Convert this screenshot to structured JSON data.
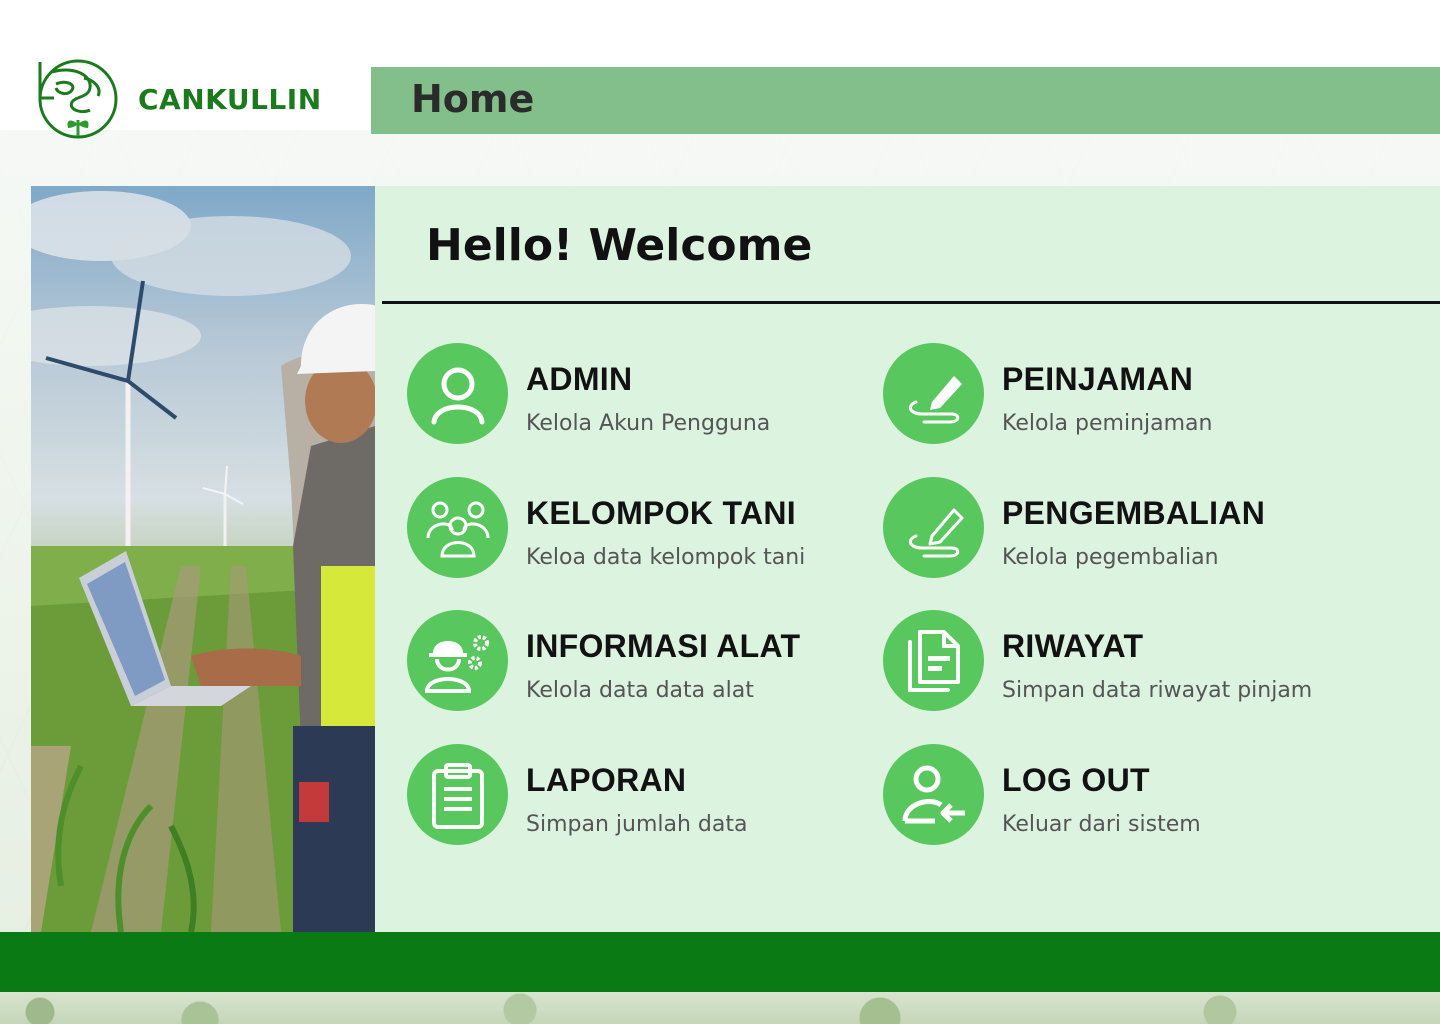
{
  "app": {
    "brand": "CANKULLIN"
  },
  "header": {
    "title": "Home"
  },
  "main": {
    "greeting": "Hello! Welcome",
    "menu": [
      {
        "title": "ADMIN",
        "subtitle": "Kelola Akun Pengguna",
        "icon": "user-icon"
      },
      {
        "title": "PEINJAMAN",
        "subtitle": "Kelola peminjaman",
        "icon": "pencil-signature-icon"
      },
      {
        "title": "KELOMPOK TANI",
        "subtitle": "Keloa data kelompok tani",
        "icon": "group-icon"
      },
      {
        "title": "PENGEMBALIAN",
        "subtitle": "Kelola pegembalian",
        "icon": "pencil-outline-icon"
      },
      {
        "title": "INFORMASI ALAT",
        "subtitle": "Kelola data data alat",
        "icon": "worker-gear-icon"
      },
      {
        "title": "RIWAYAT",
        "subtitle": "Simpan data riwayat pinjam",
        "icon": "documents-icon"
      },
      {
        "title": "LAPORAN",
        "subtitle": "Simpan jumlah data",
        "icon": "clipboard-icon"
      },
      {
        "title": "LOG OUT",
        "subtitle": "Keluar dari sistem",
        "icon": "user-logout-icon"
      }
    ]
  },
  "colors": {
    "brand": "#1b7a1c",
    "topbar": "#83bf8a",
    "panel": "#dcf3df",
    "icon_bg": "#58c75d",
    "footer": "#0a7a14"
  }
}
